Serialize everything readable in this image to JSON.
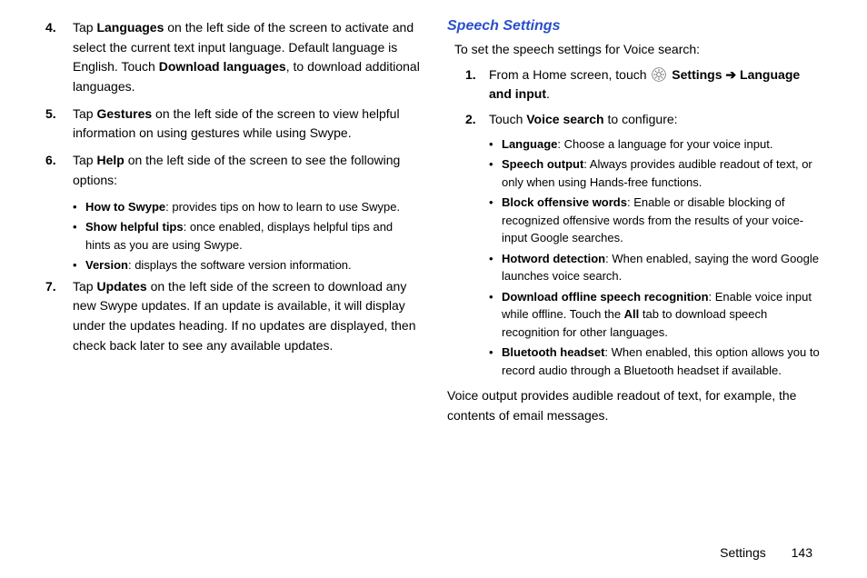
{
  "left": {
    "items": [
      {
        "num": "4.",
        "prefix": "Tap ",
        "bold1": "Languages",
        "mid": " on the left side of the screen to activate and select the current text input language. Default language is English. Touch ",
        "bold2": "Download languages",
        "suffix": ", to download additional languages."
      },
      {
        "num": "5.",
        "prefix": "Tap ",
        "bold1": "Gestures",
        "mid": " on the left side of the screen to view helpful information on using gestures while using Swype.",
        "bold2": "",
        "suffix": ""
      },
      {
        "num": "6.",
        "prefix": "Tap ",
        "bold1": "Help",
        "mid": " on the left side of the screen to see the following options:",
        "bold2": "",
        "suffix": "",
        "bullets": [
          {
            "bold": "How to Swype",
            "rest": ": provides tips on how to learn to use Swype."
          },
          {
            "bold": "Show helpful tips",
            "rest": ": once enabled, displays helpful tips and hints as you are using Swype."
          },
          {
            "bold": "Version",
            "rest": ": displays the software version information."
          }
        ]
      },
      {
        "num": "7.",
        "prefix": "Tap ",
        "bold1": "Updates",
        "mid": " on the left side of the screen to download any new Swype updates. If an update is available, it will display under the updates heading. If no updates are displayed, then check back later to see any available updates.",
        "bold2": "",
        "suffix": ""
      }
    ]
  },
  "right": {
    "title": "Speech Settings",
    "intro": "To set the speech settings for Voice search:",
    "items": [
      {
        "num": "1.",
        "prefix": "From a Home screen, touch ",
        "icon": true,
        "bold1": " Settings ",
        "arrow": "➔",
        "bold2": " Language and input",
        "suffix": "."
      },
      {
        "num": "2.",
        "prefix": "Touch ",
        "bold1": "Voice search",
        "suffix": " to configure:",
        "bullets": [
          {
            "bold": "Language",
            "rest": ": Choose a language for your voice input."
          },
          {
            "bold": "Speech output",
            "rest": ": Always provides audible readout of text, or only when using Hands-free functions."
          },
          {
            "bold": "Block offensive words",
            "rest": ": Enable or disable blocking of recognized offensive words from the results of your voice-input Google searches."
          },
          {
            "bold": "Hotword detection",
            "rest": ": When enabled, saying the word Google launches voice search."
          },
          {
            "bold": "Download offline speech recognition",
            "rest_pre": ": Enable voice input while offline. Touch the ",
            "bold2": "All",
            "rest_post": " tab to download speech recognition for other languages."
          },
          {
            "bold": "Bluetooth headset",
            "rest": ": When enabled, this option allows you to record audio through a Bluetooth headset if available."
          }
        ]
      }
    ],
    "closing": "Voice output provides audible readout of text, for example, the contents of email messages."
  },
  "footer": {
    "section": "Settings",
    "page": "143"
  }
}
